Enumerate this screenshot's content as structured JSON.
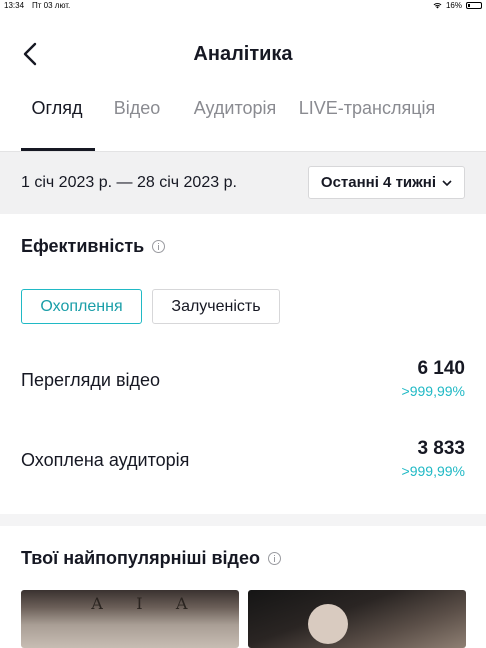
{
  "status_bar": {
    "time": "13:34",
    "date": "Пт 03 лют.",
    "battery": "16%",
    "battery_level": 0.16
  },
  "header": {
    "title": "Аналітика"
  },
  "tabs": [
    {
      "label": "Огляд",
      "active": true
    },
    {
      "label": "Відео",
      "active": false
    },
    {
      "label": "Аудиторія",
      "active": false
    },
    {
      "label": "LIVE-трансляція",
      "active": false
    }
  ],
  "date_bar": {
    "range": "1 січ 2023 р. — 28 січ 2023 р.",
    "period": "Останні 4 тижні"
  },
  "effectiveness": {
    "title": "Ефективність",
    "toggle": {
      "active": "Охоплення",
      "inactive": "Залученість"
    },
    "metrics": [
      {
        "label": "Перегляди відео",
        "value": "6 140",
        "change": ">999,99%"
      },
      {
        "label": "Охоплена аудиторія",
        "value": "3 833",
        "change": ">999,99%"
      }
    ]
  },
  "top_videos": {
    "title": "Твої найпопулярніші відео",
    "thumb_1_text": "А І А"
  },
  "colors": {
    "accent": "#20b9c5",
    "text": "#161823",
    "muted": "#8a8b91",
    "surface": "#f1f1f2"
  }
}
